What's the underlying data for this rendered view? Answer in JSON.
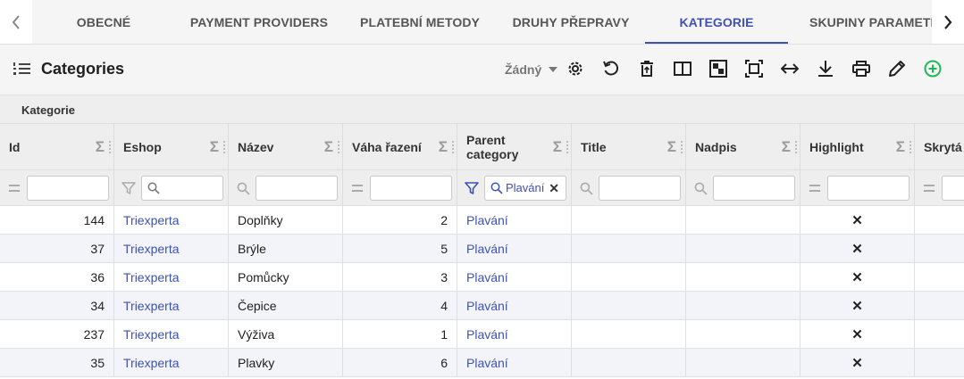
{
  "tabs": [
    {
      "label": "OBECNÉ"
    },
    {
      "label": "PAYMENT PROVIDERS"
    },
    {
      "label": "PLATEBNÍ METODY"
    },
    {
      "label": "DRUHY PŘEPRAVY"
    },
    {
      "label": "KATEGORIE",
      "active": true
    },
    {
      "label": "SKUPINY PARAMETRŮ"
    }
  ],
  "toolbar": {
    "title": "Categories",
    "density_value": "Žádný"
  },
  "group": {
    "label": "Kategorie"
  },
  "columns": [
    {
      "label": "Id"
    },
    {
      "label": "Eshop"
    },
    {
      "label": "Název"
    },
    {
      "label": "Váha řazení"
    },
    {
      "label": "Parent category"
    },
    {
      "label": "Title"
    },
    {
      "label": "Nadpis"
    },
    {
      "label": "Highlight"
    },
    {
      "label": "Skrytá"
    }
  ],
  "filters": {
    "parent_category_value": "Plavání"
  },
  "rows": [
    {
      "id": "144",
      "eshop": "Triexperta",
      "nazev": "Doplňky",
      "vaha": "2",
      "parent": "Plavání",
      "title": "",
      "nadpis": "",
      "highlight": "✕"
    },
    {
      "id": "37",
      "eshop": "Triexperta",
      "nazev": "Brýle",
      "vaha": "5",
      "parent": "Plavání",
      "title": "",
      "nadpis": "",
      "highlight": "✕"
    },
    {
      "id": "36",
      "eshop": "Triexperta",
      "nazev": "Pomůcky",
      "vaha": "3",
      "parent": "Plavání",
      "title": "",
      "nadpis": "",
      "highlight": "✕"
    },
    {
      "id": "34",
      "eshop": "Triexperta",
      "nazev": "Čepice",
      "vaha": "4",
      "parent": "Plavání",
      "title": "",
      "nadpis": "",
      "highlight": "✕"
    },
    {
      "id": "237",
      "eshop": "Triexperta",
      "nazev": "Výživa",
      "vaha": "1",
      "parent": "Plavání",
      "title": "",
      "nadpis": "",
      "highlight": "✕"
    },
    {
      "id": "35",
      "eshop": "Triexperta",
      "nazev": "Plavky",
      "vaha": "6",
      "parent": "Plavání",
      "title": "",
      "nadpis": "",
      "highlight": "✕"
    }
  ],
  "colors": {
    "accent": "#3f51b5",
    "add_button": "#1db954",
    "row_alt": "#f3f4f9",
    "header_bg": "#eeeeee"
  },
  "icons": {
    "tabs_scroll_left": "chevron-left-icon",
    "tabs_scroll_right": "chevron-right-icon",
    "list": "list-numbered-icon",
    "toolbar": [
      "gear-icon",
      "undo-icon",
      "delete-icon",
      "columns-icon",
      "checkerboard-icon",
      "fit-screen-icon",
      "expand-width-icon",
      "download-icon",
      "print-icon",
      "edit-icon",
      "add-circle-icon"
    ]
  }
}
